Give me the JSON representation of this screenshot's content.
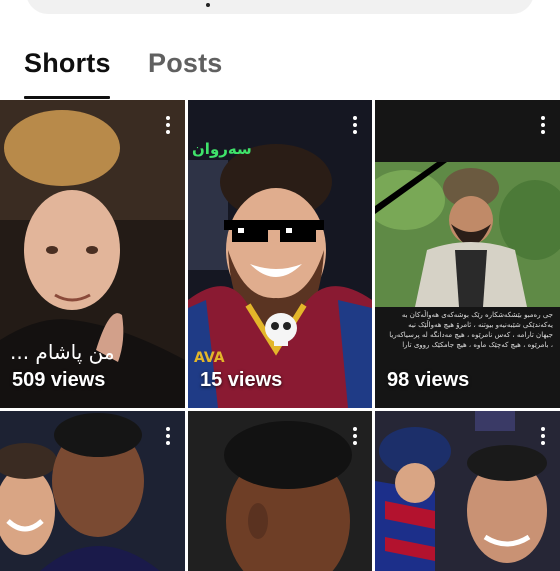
{
  "tabs": {
    "shorts": "Shorts",
    "posts": "Posts"
  },
  "shorts": [
    {
      "views": "509 views",
      "caption": "من پاشام ..."
    },
    {
      "views": "15 views",
      "sign": "سەروان"
    },
    {
      "views": "98 views",
      "caption_lines": [
        "جی رەمبو بێشکەشکارە رێک بوشەکەی هەواڵەکان بە",
        "یەکەندێکی شێبەنیەو بیوتنە ، ئامرۆ هیچ هەواڵێک نیە",
        "جیهان تارامە ، کەس نامرێوە ، هیچ مەدانگە لە پرسیاکەریا",
        "، بامرێوە ، هیچ کەچێک ماوە ، هیچ جامکێک رووی تارا"
      ]
    },
    {
      "views": ""
    },
    {
      "views": ""
    },
    {
      "views": ""
    }
  ],
  "colors": {
    "active_tab": "#0f0f0f",
    "inactive_tab": "#606060",
    "background": "#ffffff"
  }
}
